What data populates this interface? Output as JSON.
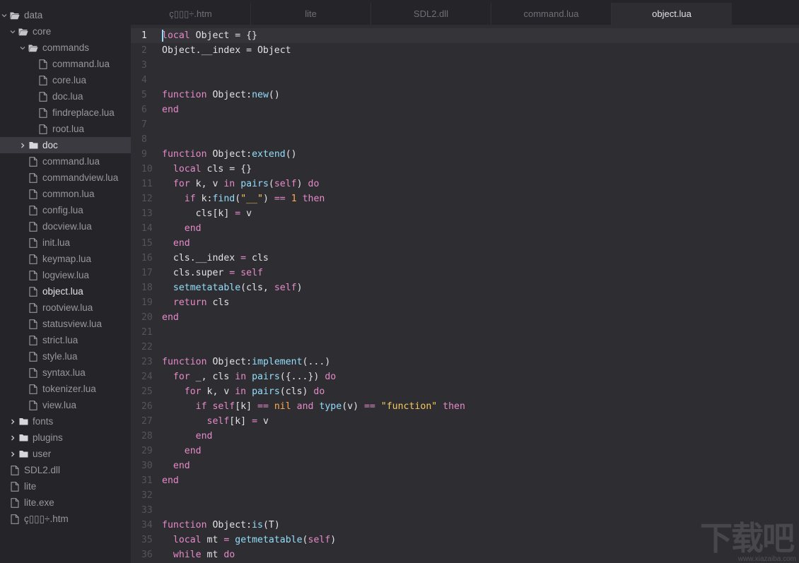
{
  "sidebar": {
    "items": [
      {
        "label": "data",
        "type": "folder",
        "open": true,
        "depth": 0
      },
      {
        "label": "core",
        "type": "folder",
        "open": true,
        "depth": 1
      },
      {
        "label": "commands",
        "type": "folder",
        "open": true,
        "depth": 2
      },
      {
        "label": "command.lua",
        "type": "file",
        "depth": 3
      },
      {
        "label": "core.lua",
        "type": "file",
        "depth": 3
      },
      {
        "label": "doc.lua",
        "type": "file",
        "depth": 3
      },
      {
        "label": "findreplace.lua",
        "type": "file",
        "depth": 3
      },
      {
        "label": "root.lua",
        "type": "file",
        "depth": 3
      },
      {
        "label": "doc",
        "type": "folder",
        "open": false,
        "depth": 2,
        "selected": true
      },
      {
        "label": "command.lua",
        "type": "file",
        "depth": 2
      },
      {
        "label": "commandview.lua",
        "type": "file",
        "depth": 2
      },
      {
        "label": "common.lua",
        "type": "file",
        "depth": 2
      },
      {
        "label": "config.lua",
        "type": "file",
        "depth": 2
      },
      {
        "label": "docview.lua",
        "type": "file",
        "depth": 2
      },
      {
        "label": "init.lua",
        "type": "file",
        "depth": 2
      },
      {
        "label": "keymap.lua",
        "type": "file",
        "depth": 2
      },
      {
        "label": "logview.lua",
        "type": "file",
        "depth": 2
      },
      {
        "label": "object.lua",
        "type": "file",
        "depth": 2,
        "active": true
      },
      {
        "label": "rootview.lua",
        "type": "file",
        "depth": 2
      },
      {
        "label": "statusview.lua",
        "type": "file",
        "depth": 2
      },
      {
        "label": "strict.lua",
        "type": "file",
        "depth": 2
      },
      {
        "label": "style.lua",
        "type": "file",
        "depth": 2
      },
      {
        "label": "syntax.lua",
        "type": "file",
        "depth": 2
      },
      {
        "label": "tokenizer.lua",
        "type": "file",
        "depth": 2
      },
      {
        "label": "view.lua",
        "type": "file",
        "depth": 2
      },
      {
        "label": "fonts",
        "type": "folder",
        "open": false,
        "depth": 1
      },
      {
        "label": "plugins",
        "type": "folder",
        "open": false,
        "depth": 1
      },
      {
        "label": "user",
        "type": "folder",
        "open": false,
        "depth": 1
      },
      {
        "label": "SDL2.dll",
        "type": "file",
        "depth": 0
      },
      {
        "label": "lite",
        "type": "file",
        "depth": 0
      },
      {
        "label": "lite.exe",
        "type": "file",
        "depth": 0
      },
      {
        "label": "ç▯▯▯÷.htm",
        "type": "file",
        "depth": 0
      }
    ]
  },
  "tabs": [
    {
      "label": "ç▯▯▯÷.htm",
      "active": false
    },
    {
      "label": "lite",
      "active": false
    },
    {
      "label": "SDL2.dll",
      "active": false
    },
    {
      "label": "command.lua",
      "active": false
    },
    {
      "label": "object.lua",
      "active": true
    }
  ],
  "editor": {
    "current_line": 1,
    "lines": [
      [
        [
          "kw",
          "local"
        ],
        [
          "t",
          " Object = {}"
        ]
      ],
      [
        [
          "t",
          "Object.__index = Object"
        ]
      ],
      [],
      [],
      [
        [
          "kw",
          "function"
        ],
        [
          "t",
          " Object:"
        ],
        [
          "fn",
          "new"
        ],
        [
          "t",
          "()"
        ]
      ],
      [
        [
          "kw",
          "end"
        ]
      ],
      [],
      [],
      [
        [
          "kw",
          "function"
        ],
        [
          "t",
          " Object:"
        ],
        [
          "fn",
          "extend"
        ],
        [
          "t",
          "()"
        ]
      ],
      [
        [
          "t",
          "  "
        ],
        [
          "kw",
          "local"
        ],
        [
          "t",
          " cls = {}"
        ]
      ],
      [
        [
          "t",
          "  "
        ],
        [
          "kw",
          "for"
        ],
        [
          "t",
          " k, v "
        ],
        [
          "kw",
          "in"
        ],
        [
          "t",
          " "
        ],
        [
          "fn",
          "pairs"
        ],
        [
          "t",
          "("
        ],
        [
          "kw",
          "self"
        ],
        [
          "t",
          ") "
        ],
        [
          "kw",
          "do"
        ]
      ],
      [
        [
          "t",
          "    "
        ],
        [
          "kw",
          "if"
        ],
        [
          "t",
          " k:"
        ],
        [
          "fn",
          "find"
        ],
        [
          "t",
          "("
        ],
        [
          "str",
          "\"__\""
        ],
        [
          "t",
          ") "
        ],
        [
          "kw",
          "=="
        ],
        [
          "t",
          " "
        ],
        [
          "lit",
          "1"
        ],
        [
          "t",
          " "
        ],
        [
          "kw",
          "then"
        ]
      ],
      [
        [
          "t",
          "      cls[k] "
        ],
        [
          "kw",
          "="
        ],
        [
          "t",
          " v"
        ]
      ],
      [
        [
          "t",
          "    "
        ],
        [
          "kw",
          "end"
        ]
      ],
      [
        [
          "t",
          "  "
        ],
        [
          "kw",
          "end"
        ]
      ],
      [
        [
          "t",
          "  cls.__index "
        ],
        [
          "kw",
          "="
        ],
        [
          "t",
          " cls"
        ]
      ],
      [
        [
          "t",
          "  cls.super "
        ],
        [
          "kw",
          "="
        ],
        [
          "t",
          " "
        ],
        [
          "kw",
          "self"
        ]
      ],
      [
        [
          "t",
          "  "
        ],
        [
          "fn",
          "setmetatable"
        ],
        [
          "t",
          "(cls, "
        ],
        [
          "kw",
          "self"
        ],
        [
          "t",
          ")"
        ]
      ],
      [
        [
          "t",
          "  "
        ],
        [
          "kw",
          "return"
        ],
        [
          "t",
          " cls"
        ]
      ],
      [
        [
          "kw",
          "end"
        ]
      ],
      [],
      [],
      [
        [
          "kw",
          "function"
        ],
        [
          "t",
          " Object:"
        ],
        [
          "fn",
          "implement"
        ],
        [
          "t",
          "(...)"
        ]
      ],
      [
        [
          "t",
          "  "
        ],
        [
          "kw",
          "for"
        ],
        [
          "t",
          " _, cls "
        ],
        [
          "kw",
          "in"
        ],
        [
          "t",
          " "
        ],
        [
          "fn",
          "pairs"
        ],
        [
          "t",
          "({...}) "
        ],
        [
          "kw",
          "do"
        ]
      ],
      [
        [
          "t",
          "    "
        ],
        [
          "kw",
          "for"
        ],
        [
          "t",
          " k, v "
        ],
        [
          "kw",
          "in"
        ],
        [
          "t",
          " "
        ],
        [
          "fn",
          "pairs"
        ],
        [
          "t",
          "(cls) "
        ],
        [
          "kw",
          "do"
        ]
      ],
      [
        [
          "t",
          "      "
        ],
        [
          "kw",
          "if"
        ],
        [
          "t",
          " "
        ],
        [
          "kw",
          "self"
        ],
        [
          "t",
          "[k] "
        ],
        [
          "kw",
          "=="
        ],
        [
          "t",
          " "
        ],
        [
          "lit",
          "nil"
        ],
        [
          "t",
          " "
        ],
        [
          "kw",
          "and"
        ],
        [
          "t",
          " "
        ],
        [
          "fn",
          "type"
        ],
        [
          "t",
          "(v) "
        ],
        [
          "kw",
          "=="
        ],
        [
          "t",
          " "
        ],
        [
          "str",
          "\"function\""
        ],
        [
          "t",
          " "
        ],
        [
          "kw",
          "then"
        ]
      ],
      [
        [
          "t",
          "        "
        ],
        [
          "kw",
          "self"
        ],
        [
          "t",
          "[k] "
        ],
        [
          "kw",
          "="
        ],
        [
          "t",
          " v"
        ]
      ],
      [
        [
          "t",
          "      "
        ],
        [
          "kw",
          "end"
        ]
      ],
      [
        [
          "t",
          "    "
        ],
        [
          "kw",
          "end"
        ]
      ],
      [
        [
          "t",
          "  "
        ],
        [
          "kw",
          "end"
        ]
      ],
      [
        [
          "kw",
          "end"
        ]
      ],
      [],
      [],
      [
        [
          "kw",
          "function"
        ],
        [
          "t",
          " Object:"
        ],
        [
          "fn",
          "is"
        ],
        [
          "t",
          "(T)"
        ]
      ],
      [
        [
          "t",
          "  "
        ],
        [
          "kw",
          "local"
        ],
        [
          "t",
          " mt "
        ],
        [
          "kw",
          "="
        ],
        [
          "t",
          " "
        ],
        [
          "fn",
          "getmetatable"
        ],
        [
          "t",
          "("
        ],
        [
          "kw",
          "self"
        ],
        [
          "t",
          ")"
        ]
      ],
      [
        [
          "t",
          "  "
        ],
        [
          "kw",
          "while"
        ],
        [
          "t",
          " mt "
        ],
        [
          "kw",
          "do"
        ]
      ]
    ]
  },
  "watermark": {
    "big": "下载吧",
    "small": "www.xiazaiba.com"
  },
  "colors": {
    "keyword": "#e58ac9",
    "function": "#93ddfa",
    "literal": "#ffa94d",
    "string": "#f7c95c",
    "text": "#e1e1e6"
  }
}
